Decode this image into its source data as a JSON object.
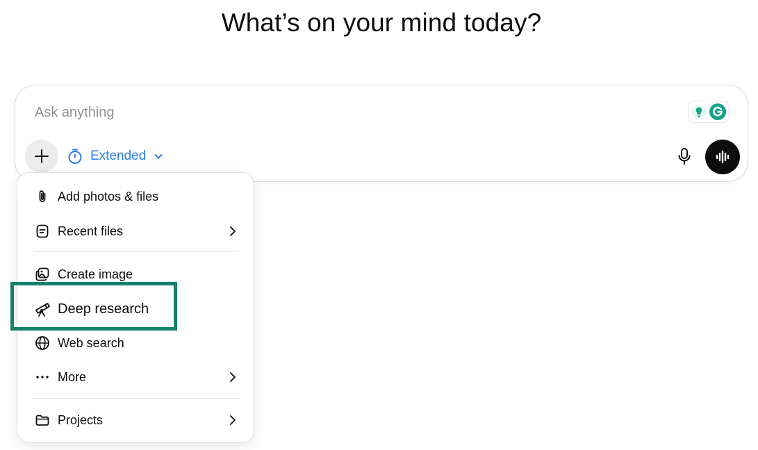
{
  "headline": "What’s on your mind today?",
  "composer": {
    "placeholder": "Ask anything",
    "mode_label": "Extended",
    "icons": {
      "plus": "plus-icon",
      "mode": "timer-icon",
      "chevron": "chevron-down-icon",
      "mic": "microphone-icon",
      "voice": "voice-waveform-icon",
      "grammarly": "grammarly-icon",
      "idea": "lightbulb-icon"
    }
  },
  "menu": {
    "items": [
      {
        "label": "Add photos & files",
        "icon": "paperclip-icon",
        "submenu": false
      },
      {
        "label": "Recent files",
        "icon": "file-icon",
        "submenu": true
      },
      {
        "label": "Create image",
        "icon": "image-icon",
        "submenu": false
      },
      {
        "label": "Deep research",
        "icon": "telescope-icon",
        "submenu": false
      },
      {
        "label": "Web search",
        "icon": "globe-icon",
        "submenu": false
      },
      {
        "label": "More",
        "icon": "more-dots-icon",
        "submenu": true
      },
      {
        "label": "Projects",
        "icon": "folder-icon",
        "submenu": true
      }
    ]
  },
  "colors": {
    "accent_blue": "#2b7de9",
    "highlight_green": "#17806b",
    "grammarly_green": "#15a38a"
  }
}
